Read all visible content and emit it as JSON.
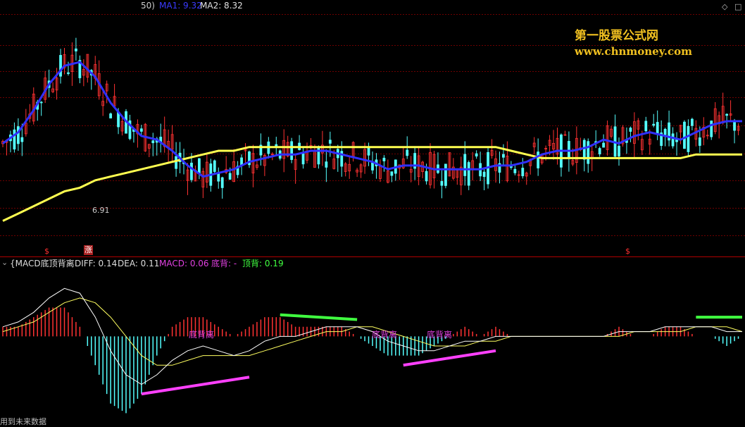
{
  "main_panel": {
    "header": {
      "prefix": "50)",
      "ma1_label": "MA1: 9.32",
      "ma2_label": "MA2: 8.32",
      "ma1_color": "#3030ff",
      "ma2_color": "#ffff50"
    },
    "low_label": "6.91",
    "signal_markers": [
      "$",
      "涨",
      "$"
    ],
    "watermark": {
      "title": "第一股票公式网",
      "url": "www.chnmoney.com",
      "color": "#f0c020"
    }
  },
  "indicator_panel": {
    "collapse_icon": "collapse-icon",
    "title": "{MACD底顶背离",
    "diff_label": "DIFF: 0.14",
    "dea_label": "DEA: 0.11",
    "macd_label": "MACD: 0.06",
    "bottom_div_label": "底背: -",
    "top_div_label": "顶背: 0.19",
    "divergence_tags": [
      "底背离",
      "底背离",
      "底背离"
    ],
    "footer_note": "用到未来数据"
  },
  "window_controls": [
    "diamond-icon",
    "square-icon"
  ],
  "colors": {
    "up_candle": "#ff3232",
    "down_candle": "#54ffff",
    "grid": "#6e0000",
    "macd_positive": "#ff3232",
    "macd_negative": "#54ffff",
    "diff_line": "#ffffff",
    "bottom_divergence": "#ff40ff",
    "top_divergence": "#40ff40"
  },
  "chart_data": [
    {
      "type": "candlestick",
      "title": "",
      "series": [
        {
          "name": "MA1",
          "color": "#3030ff",
          "values": [
            8.3,
            8.6,
            9.2,
            9.9,
            10.4,
            10.5,
            10.1,
            9.4,
            8.9,
            8.5,
            8.4,
            8.1,
            7.7,
            7.4,
            7.5,
            7.6,
            7.8,
            7.9,
            8.0,
            8.0,
            8.1,
            8.1,
            8.0,
            7.9,
            7.8,
            7.6,
            7.7,
            7.7,
            7.6,
            7.6,
            7.6,
            7.6,
            7.7,
            7.7,
            7.8,
            8.0,
            8.1,
            8.1,
            8.2,
            8.4,
            8.3,
            8.5,
            8.6,
            8.5,
            8.4,
            8.6,
            8.8,
            8.9,
            8.9
          ]
        },
        {
          "name": "MA2",
          "color": "#ffff50",
          "values": [
            6.2,
            6.4,
            6.6,
            6.8,
            7.0,
            7.1,
            7.3,
            7.4,
            7.5,
            7.6,
            7.7,
            7.8,
            7.9,
            8.0,
            8.1,
            8.1,
            8.2,
            8.2,
            8.2,
            8.2,
            8.2,
            8.2,
            8.2,
            8.2,
            8.2,
            8.2,
            8.2,
            8.2,
            8.2,
            8.2,
            8.2,
            8.2,
            8.2,
            8.1,
            8.0,
            7.9,
            7.9,
            7.9,
            7.9,
            7.9,
            7.9,
            7.9,
            7.9,
            7.9,
            7.9,
            8.0,
            8.0,
            8.0,
            8.0
          ]
        }
      ],
      "candles_summary": {
        "count": 49,
        "high": 10.9,
        "low": 6.91
      },
      "ylim": [
        5.6,
        11.8
      ]
    },
    {
      "type": "bar",
      "title": "MACD",
      "series": [
        {
          "name": "DIFF",
          "values": [
            0.2,
            0.3,
            0.5,
            0.8,
            1.0,
            0.9,
            0.4,
            -0.3,
            -0.8,
            -1.0,
            -0.8,
            -0.5,
            -0.3,
            -0.2,
            -0.3,
            -0.4,
            -0.3,
            -0.1,
            0.0,
            0.0,
            0.1,
            0.2,
            0.2,
            0.2,
            0.1,
            -0.1,
            -0.2,
            -0.3,
            -0.3,
            -0.2,
            -0.1,
            -0.1,
            0.0,
            0.0,
            0.0,
            0.0,
            0.0,
            0.0,
            0.0,
            0.0,
            0.1,
            0.1,
            0.1,
            0.2,
            0.2,
            0.2,
            0.2,
            0.1,
            0.1
          ]
        },
        {
          "name": "DEA",
          "values": [
            0.1,
            0.2,
            0.3,
            0.5,
            0.7,
            0.8,
            0.7,
            0.4,
            0.0,
            -0.4,
            -0.6,
            -0.6,
            -0.5,
            -0.4,
            -0.4,
            -0.4,
            -0.4,
            -0.3,
            -0.2,
            -0.1,
            0.0,
            0.1,
            0.1,
            0.2,
            0.2,
            0.1,
            0.0,
            -0.1,
            -0.2,
            -0.2,
            -0.2,
            -0.1,
            -0.1,
            0.0,
            0.0,
            0.0,
            0.0,
            0.0,
            0.0,
            0.0,
            0.0,
            0.1,
            0.1,
            0.1,
            0.1,
            0.2,
            0.2,
            0.2,
            0.1
          ]
        },
        {
          "name": "MACD",
          "values": [
            0.2,
            0.2,
            0.4,
            0.6,
            0.6,
            0.2,
            -0.6,
            -1.4,
            -1.6,
            -1.2,
            -0.4,
            0.2,
            0.4,
            0.4,
            0.2,
            0.0,
            0.2,
            0.4,
            0.4,
            0.2,
            0.2,
            0.2,
            0.2,
            0.0,
            -0.2,
            -0.4,
            -0.4,
            -0.4,
            -0.2,
            0.0,
            0.2,
            0.0,
            0.2,
            0.0,
            0.0,
            0.0,
            0.0,
            0.0,
            0.0,
            0.0,
            0.2,
            0.0,
            0.0,
            0.2,
            0.2,
            0.0,
            0.0,
            -0.2,
            0.0
          ]
        }
      ],
      "ylim": [
        -1.8,
        1.4
      ]
    }
  ]
}
